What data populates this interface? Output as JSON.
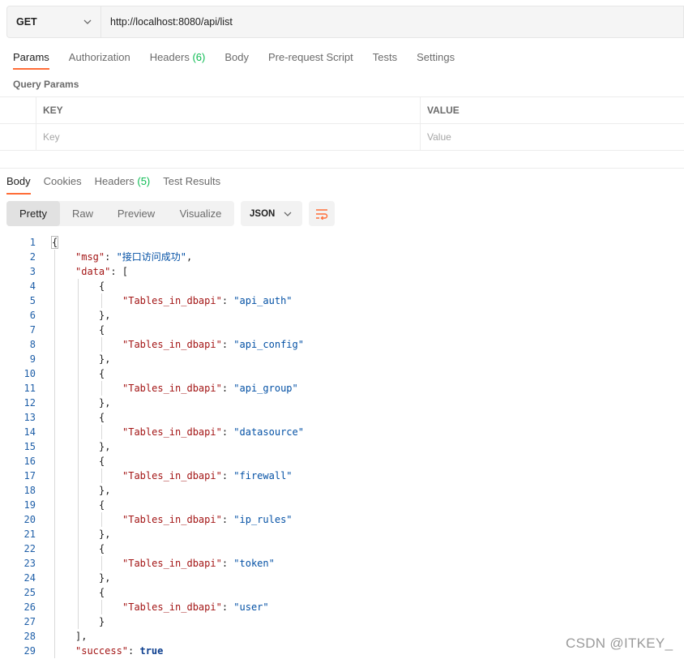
{
  "request": {
    "method": "GET",
    "url": "http://localhost:8080/api/list"
  },
  "request_tabs": [
    {
      "label": "Params",
      "count": ""
    },
    {
      "label": "Authorization",
      "count": ""
    },
    {
      "label": "Headers",
      "count": "(6)"
    },
    {
      "label": "Body",
      "count": ""
    },
    {
      "label": "Pre-request Script",
      "count": ""
    },
    {
      "label": "Tests",
      "count": ""
    },
    {
      "label": "Settings",
      "count": ""
    }
  ],
  "query_params": {
    "title": "Query Params",
    "key_header": "KEY",
    "value_header": "VALUE",
    "key_placeholder": "Key",
    "value_placeholder": "Value"
  },
  "response_tabs": [
    {
      "label": "Body",
      "count": ""
    },
    {
      "label": "Cookies",
      "count": ""
    },
    {
      "label": "Headers",
      "count": "(5)"
    },
    {
      "label": "Test Results",
      "count": ""
    }
  ],
  "view_modes": [
    "Pretty",
    "Raw",
    "Preview",
    "Visualize"
  ],
  "format": "JSON",
  "response_json": {
    "msg_key": "\"msg\"",
    "msg_value": "\"接口访问成功\"",
    "data_key": "\"data\"",
    "item_key": "\"Tables_in_dbapi\"",
    "items": [
      "\"api_auth\"",
      "\"api_config\"",
      "\"api_group\"",
      "\"datasource\"",
      "\"firewall\"",
      "\"ip_rules\"",
      "\"token\"",
      "\"user\""
    ],
    "success_key": "\"success\"",
    "success_value": "true"
  },
  "line_numbers": [
    "1",
    "2",
    "3",
    "4",
    "5",
    "6",
    "7",
    "8",
    "9",
    "10",
    "11",
    "12",
    "13",
    "14",
    "15",
    "16",
    "17",
    "18",
    "19",
    "20",
    "21",
    "22",
    "23",
    "24",
    "25",
    "26",
    "27",
    "28",
    "29"
  ],
  "watermark": "CSDN @ITKEY_",
  "colors": {
    "accent": "#ff6c37",
    "count": "#0cbb52",
    "json_key": "#a31515",
    "json_string": "#0451a5"
  }
}
